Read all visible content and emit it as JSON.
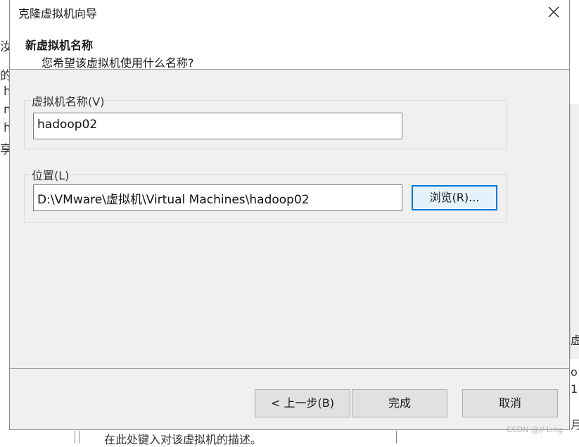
{
  "dialog": {
    "title": "克隆虚拟机向导",
    "header_title": "新虚拟机名称",
    "header_subtitle": "您希望该虚拟机使用什么名称?"
  },
  "name_group": {
    "label": "虚拟机名称(V)",
    "value": "hadoop02"
  },
  "location_group": {
    "label": "位置(L)",
    "value": "D:\\VMware\\虚拟机\\Virtual Machines\\hadoop02",
    "browse_label": "浏览(R)..."
  },
  "buttons": {
    "back": "< 上一步(B)",
    "finish": "完成",
    "cancel": "取消"
  },
  "background": {
    "left_fragments": [
      "汝",
      "的",
      "h",
      "n",
      "h",
      "享"
    ],
    "right_fragments": [
      "虚",
      "o",
      "1",
      "月"
    ],
    "bottom_text": "在此处键入对该虚拟机的描述。",
    "watermark": "CSDN @// Ling"
  },
  "icons": {
    "close": "close-icon"
  },
  "colors": {
    "focus_accent": "#0078d7",
    "dialog_bg": "#f0f0f0"
  }
}
